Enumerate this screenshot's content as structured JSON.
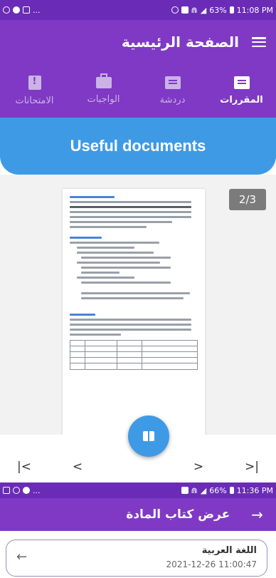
{
  "screen1": {
    "status_bar": {
      "time": "11:08 PM",
      "battery": "63%"
    },
    "app_bar": {
      "title": "الصفحة الرئيسية"
    },
    "tabs": [
      {
        "label": "المقررات",
        "icon": "chat-square-icon",
        "active": true
      },
      {
        "label": "دردشة",
        "icon": "chat-icon",
        "active": false
      },
      {
        "label": "الواجبات",
        "icon": "briefcase-icon",
        "active": false
      },
      {
        "label": "الامتحانات",
        "icon": "exam-icon",
        "active": false
      }
    ],
    "banner": {
      "title": "Useful documents"
    },
    "document": {
      "page_indicator": "2/3"
    },
    "navigation": {
      "first": "|<",
      "prev": "<",
      "next": ">",
      "last": ">|"
    }
  },
  "screen2": {
    "status_bar": {
      "time": "11:36 PM",
      "battery": "66%"
    },
    "app_bar": {
      "title": "عرض كتاب المادة",
      "back_arrow": "→"
    },
    "item": {
      "name": "اللغة العربية",
      "date": "2021-12-26 11:00:47",
      "arrow": "←"
    }
  },
  "colors": {
    "purple": "#7f39c4",
    "purple_dark": "#6a2cb6",
    "blue": "#3f9ae6"
  }
}
